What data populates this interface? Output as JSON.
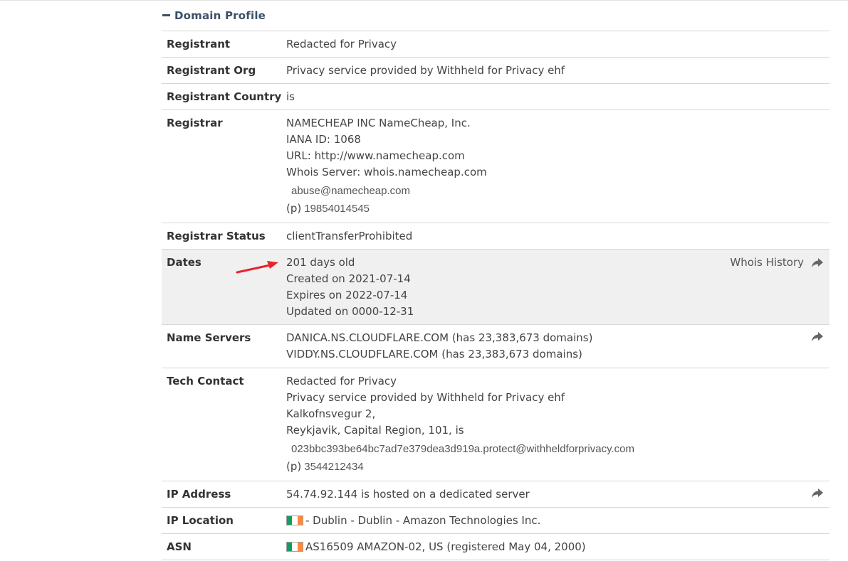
{
  "section": {
    "title": "Domain Profile",
    "collapse_icon": "minus-icon"
  },
  "rows": {
    "registrant": {
      "label": "Registrant",
      "value": "Redacted for Privacy"
    },
    "registrant_org": {
      "label": "Registrant Org",
      "value": "Privacy service provided by Withheld for Privacy ehf"
    },
    "registrant_country": {
      "label": "Registrant Country",
      "value": "is"
    },
    "registrar": {
      "label": "Registrar",
      "lines": [
        "NAMECHEAP INC NameCheap, Inc.",
        "IANA ID: 1068",
        "URL: http://www.namecheap.com",
        "Whois Server: whois.namecheap.com"
      ],
      "email": "abuse@namecheap.com",
      "phone_prefix": "(p)",
      "phone": "19854014545"
    },
    "registrar_status": {
      "label": "Registrar Status",
      "value": "clientTransferProhibited"
    },
    "dates": {
      "label": "Dates",
      "lines": [
        "201 days old",
        "Created on 2021-07-14",
        "Expires on 2022-07-14",
        "Updated on 0000-12-31"
      ],
      "link_label": "Whois History",
      "link_icon": "share-arrow-icon"
    },
    "name_servers": {
      "label": "Name Servers",
      "lines": [
        "DANICA.NS.CLOUDFLARE.COM (has 23,383,673 domains)",
        "VIDDY.NS.CLOUDFLARE.COM (has 23,383,673 domains)"
      ],
      "link_icon": "share-arrow-icon"
    },
    "tech_contact": {
      "label": "Tech Contact",
      "lines": [
        "Redacted for Privacy",
        "Privacy service provided by Withheld for Privacy ehf",
        "Kalkofnsvegur 2,",
        "Reykjavik, Capital Region, 101, is"
      ],
      "email": "023bbc393be64bc7ad7e379dea3d919a.protect@withheldforprivacy.com",
      "phone_prefix": "(p)",
      "phone": "3544212434"
    },
    "ip_address": {
      "label": "IP Address",
      "value": "54.74.92.144 is hosted on a dedicated server",
      "link_icon": "share-arrow-icon"
    },
    "ip_location": {
      "label": "IP Location",
      "value": "- Dublin - Dublin - Amazon Technologies Inc.",
      "flag_icon": "ireland-flag-icon"
    },
    "asn": {
      "label": "ASN",
      "value": "AS16509 AMAZON-02, US (registered May 04, 2000)",
      "flag_icon": "ireland-flag-icon"
    }
  },
  "annotation": {
    "arrow_color": "#e8232a",
    "icon": "red-arrow-icon"
  },
  "colors": {
    "heading": "#3a5068",
    "row_border": "#d6d6d6",
    "shaded_row": "#f0f0f0",
    "flag_green": "#169b62",
    "flag_white": "#ffffff",
    "flag_orange": "#ff883e"
  }
}
